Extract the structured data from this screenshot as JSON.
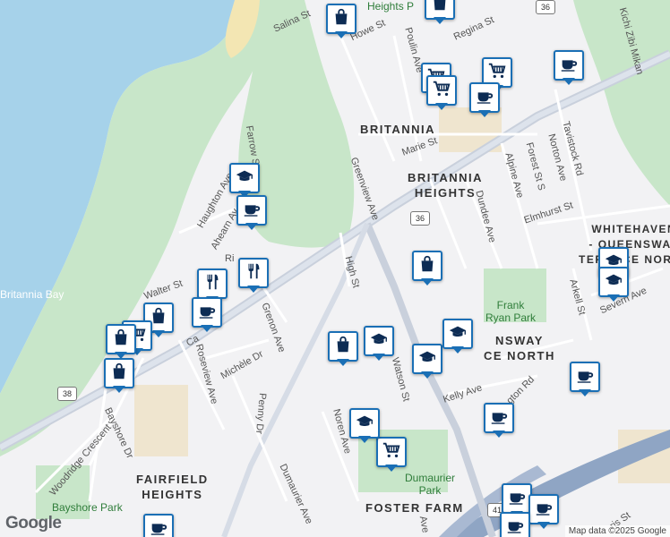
{
  "map": {
    "areas": [
      {
        "id": "britannia",
        "text": "BRITANNIA"
      },
      {
        "id": "britannia-heights",
        "text": "BRITANNIA\nHEIGHTS"
      },
      {
        "id": "whitehaven",
        "text": "WHITEHAVEN\n- QUEENSWAY\nTERRACE NORTH"
      },
      {
        "id": "queensway-terrace",
        "text": "NSWAY\nCE NORTH"
      },
      {
        "id": "fairfield",
        "text": "FAIRFIELD\nHEIGHTS"
      },
      {
        "id": "foster-farm",
        "text": "FOSTER FARM"
      },
      {
        "id": "heights-top",
        "text": "Heights P"
      }
    ],
    "parks": [
      {
        "id": "frank-ryan",
        "text": "Frank\nRyan Park"
      },
      {
        "id": "dumaurier",
        "text": "Dumaurier\nPark"
      },
      {
        "id": "bayshore",
        "text": "Bayshore Park"
      }
    ],
    "water": [
      {
        "id": "britannia-bay",
        "text": "Britannia Bay"
      }
    ],
    "streets": [
      {
        "id": "salina",
        "text": "Salina St"
      },
      {
        "id": "howe",
        "text": "Howe St"
      },
      {
        "id": "poulin",
        "text": "Poulin Ave"
      },
      {
        "id": "regina",
        "text": "Regina St"
      },
      {
        "id": "kichi",
        "text": "Kichi Zibi Mikan"
      },
      {
        "id": "farrow",
        "text": "Farrow St"
      },
      {
        "id": "greenview",
        "text": "Greenview Ave"
      },
      {
        "id": "marie",
        "text": "Marie St"
      },
      {
        "id": "tavistock",
        "text": "Tavistock Rd"
      },
      {
        "id": "norton",
        "text": "Norton Ave"
      },
      {
        "id": "forest",
        "text": "Forest St S"
      },
      {
        "id": "alpine",
        "text": "Alpine Ave"
      },
      {
        "id": "dundee",
        "text": "Dundee Ave"
      },
      {
        "id": "elmhurst",
        "text": "Elmhurst St"
      },
      {
        "id": "haughton",
        "text": "Haughton Ave"
      },
      {
        "id": "ahearn",
        "text": "Ahearn Av"
      },
      {
        "id": "high",
        "text": "High St"
      },
      {
        "id": "walter",
        "text": "Walter St"
      },
      {
        "id": "grenon",
        "text": "Grenon Ave"
      },
      {
        "id": "arkell",
        "text": "Arkell St"
      },
      {
        "id": "severn",
        "text": "Severn Ave"
      },
      {
        "id": "ca",
        "text": "Ca"
      },
      {
        "id": "roseview",
        "text": "Roseview Ave"
      },
      {
        "id": "michele",
        "text": "Michèle Dr"
      },
      {
        "id": "watson",
        "text": "Watson St"
      },
      {
        "id": "kelly",
        "text": "Kelly Ave"
      },
      {
        "id": "gton",
        "text": "gton Rd"
      },
      {
        "id": "penny",
        "text": "Penny Dr"
      },
      {
        "id": "noren",
        "text": "Noren Ave"
      },
      {
        "id": "bayshore-dr",
        "text": "Bayshore Dr"
      },
      {
        "id": "woodridge",
        "text": "Woodridge Crescent"
      },
      {
        "id": "dumaurier-ave",
        "text": "Dumaurier Ave"
      },
      {
        "id": "ave-bottom",
        "text": "Ave"
      },
      {
        "id": "ris",
        "text": "ris St"
      },
      {
        "id": "ri",
        "text": "Ri"
      }
    ],
    "route_shields": [
      {
        "id": "r36-top",
        "text": "36"
      },
      {
        "id": "r36-mid",
        "text": "36"
      },
      {
        "id": "r38",
        "text": "38"
      },
      {
        "id": "r41",
        "text": "41"
      }
    ],
    "pins": [
      {
        "type": "shop",
        "name": "shop-pin"
      },
      {
        "type": "shop",
        "name": "shop-pin"
      },
      {
        "type": "cart",
        "name": "cart-pin"
      },
      {
        "type": "cart",
        "name": "cart-pin"
      },
      {
        "type": "cart",
        "name": "cart-pin"
      },
      {
        "type": "cafe",
        "name": "cafe-pin"
      },
      {
        "type": "cafe",
        "name": "cafe-pin"
      },
      {
        "type": "school",
        "name": "school-pin"
      },
      {
        "type": "cafe",
        "name": "cafe-pin"
      },
      {
        "type": "restaurant",
        "name": "restaurant-pin"
      },
      {
        "type": "restaurant",
        "name": "restaurant-pin"
      },
      {
        "type": "cafe",
        "name": "cafe-pin"
      },
      {
        "type": "shop",
        "name": "shop-pin"
      },
      {
        "type": "cart",
        "name": "cart-pin"
      },
      {
        "type": "shop",
        "name": "shop-pin"
      },
      {
        "type": "shop",
        "name": "shop-pin"
      },
      {
        "type": "shop",
        "name": "shop-pin"
      },
      {
        "type": "shop",
        "name": "shop-pin"
      },
      {
        "type": "school",
        "name": "school-pin"
      },
      {
        "type": "school",
        "name": "school-pin"
      },
      {
        "type": "school",
        "name": "school-pin"
      },
      {
        "type": "school",
        "name": "school-pin"
      },
      {
        "type": "school",
        "name": "school-pin"
      },
      {
        "type": "cafe",
        "name": "cafe-pin"
      },
      {
        "type": "cafe",
        "name": "cafe-pin"
      },
      {
        "type": "cart",
        "name": "cart-pin"
      },
      {
        "type": "school",
        "name": "school-pin"
      },
      {
        "type": "cafe",
        "name": "cafe-pin"
      },
      {
        "type": "cafe",
        "name": "cafe-pin"
      },
      {
        "type": "cafe",
        "name": "cafe-pin"
      },
      {
        "type": "cafe",
        "name": "cafe-pin"
      }
    ],
    "attribution": "Map data ©2025 Google",
    "logo": "Google"
  }
}
